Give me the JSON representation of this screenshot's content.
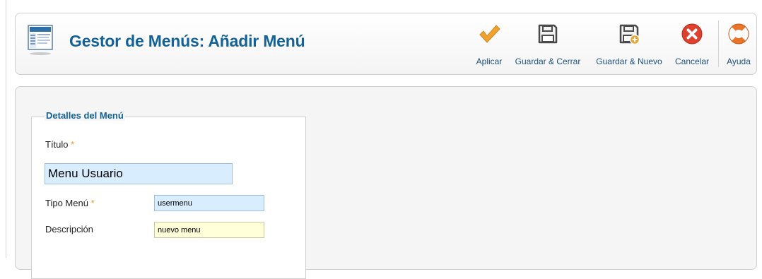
{
  "header": {
    "title": "Gestor de Menús: Añadir Menú"
  },
  "toolbar": {
    "apply_label": "Aplicar",
    "save_close_label": "Guardar & Cerrar",
    "save_new_label": "Guardar & Nuevo",
    "cancel_label": "Cancelar",
    "help_label": "Ayuda"
  },
  "form": {
    "legend": "Detalles del Menú",
    "required_marker": "*",
    "title_label": "Título",
    "title_value": "Menu Usuario",
    "menu_type_label": "Tipo Menú",
    "menu_type_value": "usermenu",
    "description_label": "Descripción",
    "description_value": "nuevo menu"
  },
  "icons": {
    "page": "menu-manager-icon",
    "apply": "checkmark-icon",
    "save_close": "save-icon",
    "save_new": "save-new-icon",
    "cancel": "cancel-icon",
    "help": "help-lifebuoy-icon"
  },
  "colors": {
    "title": "#146295",
    "toolbar_label": "#1b4f82",
    "required": "#f19b29",
    "input_bg": "#d8eeff",
    "input_focus_bg": "#ffffd9",
    "cancel_red": "#e0412f",
    "apply_orange": "#f0a22e"
  }
}
